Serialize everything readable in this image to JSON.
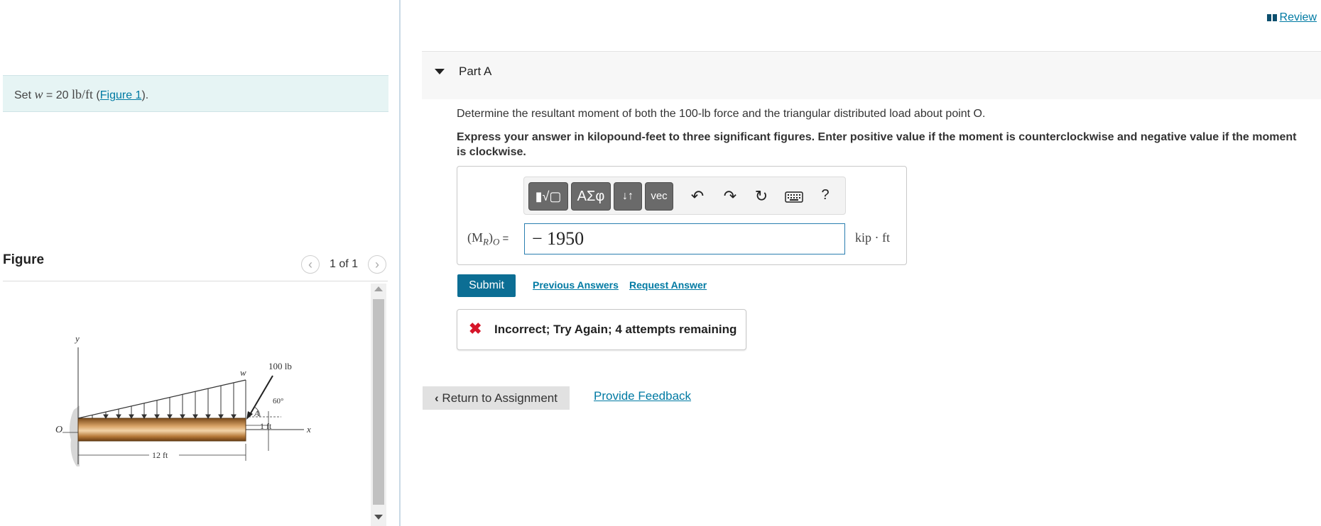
{
  "problem": {
    "prefix": "Set ",
    "var": "w",
    "equals": " = 20 ",
    "unit": "lb/ft",
    "open_paren": " (",
    "figure_link": "Figure 1",
    "close_paren": ")."
  },
  "figure_panel": {
    "heading": "Figure",
    "pager": "1 of 1",
    "prev_symbol": "‹",
    "next_symbol": "›",
    "figure_labels": {
      "y": "y",
      "w": "w",
      "force": "100 lb",
      "angle": "60°",
      "a": "A",
      "one_ft": "1 ft",
      "x": "x",
      "o": "O",
      "length": "12 ft"
    }
  },
  "header": {
    "review_label": "Review"
  },
  "part": {
    "title": "Part A",
    "question": "Determine the resultant moment of both the 100-lb force and the triangular distributed load about point O.",
    "instructions": "Express your answer in kilopound-feet to three significant figures. Enter positive value if the moment is counterclockwise and negative value if the moment is clockwise."
  },
  "toolbar": {
    "templates_label": "▮√▢",
    "greek_label": "ΑΣφ",
    "arrows_label": "↓↑",
    "vec_label": "vec",
    "help_label": "?"
  },
  "answer": {
    "label": "(M",
    "label_sub": "R",
    "label_end": ")",
    "label_sub2": "O",
    "label_eq": " =",
    "value": "− 1950",
    "units": "kip · ft"
  },
  "actions": {
    "submit": "Submit",
    "previous_answers": "Previous Answers",
    "request_answer": "Request Answer"
  },
  "feedback": {
    "message": "Incorrect; Try Again; 4 attempts remaining"
  },
  "footer": {
    "return": "Return to Assignment",
    "provide_feedback": "Provide Feedback"
  },
  "colors": {
    "link": "#007aa3",
    "submit": "#0c6e94",
    "error": "#d6162a",
    "problem_bg": "#e6f4f4"
  }
}
